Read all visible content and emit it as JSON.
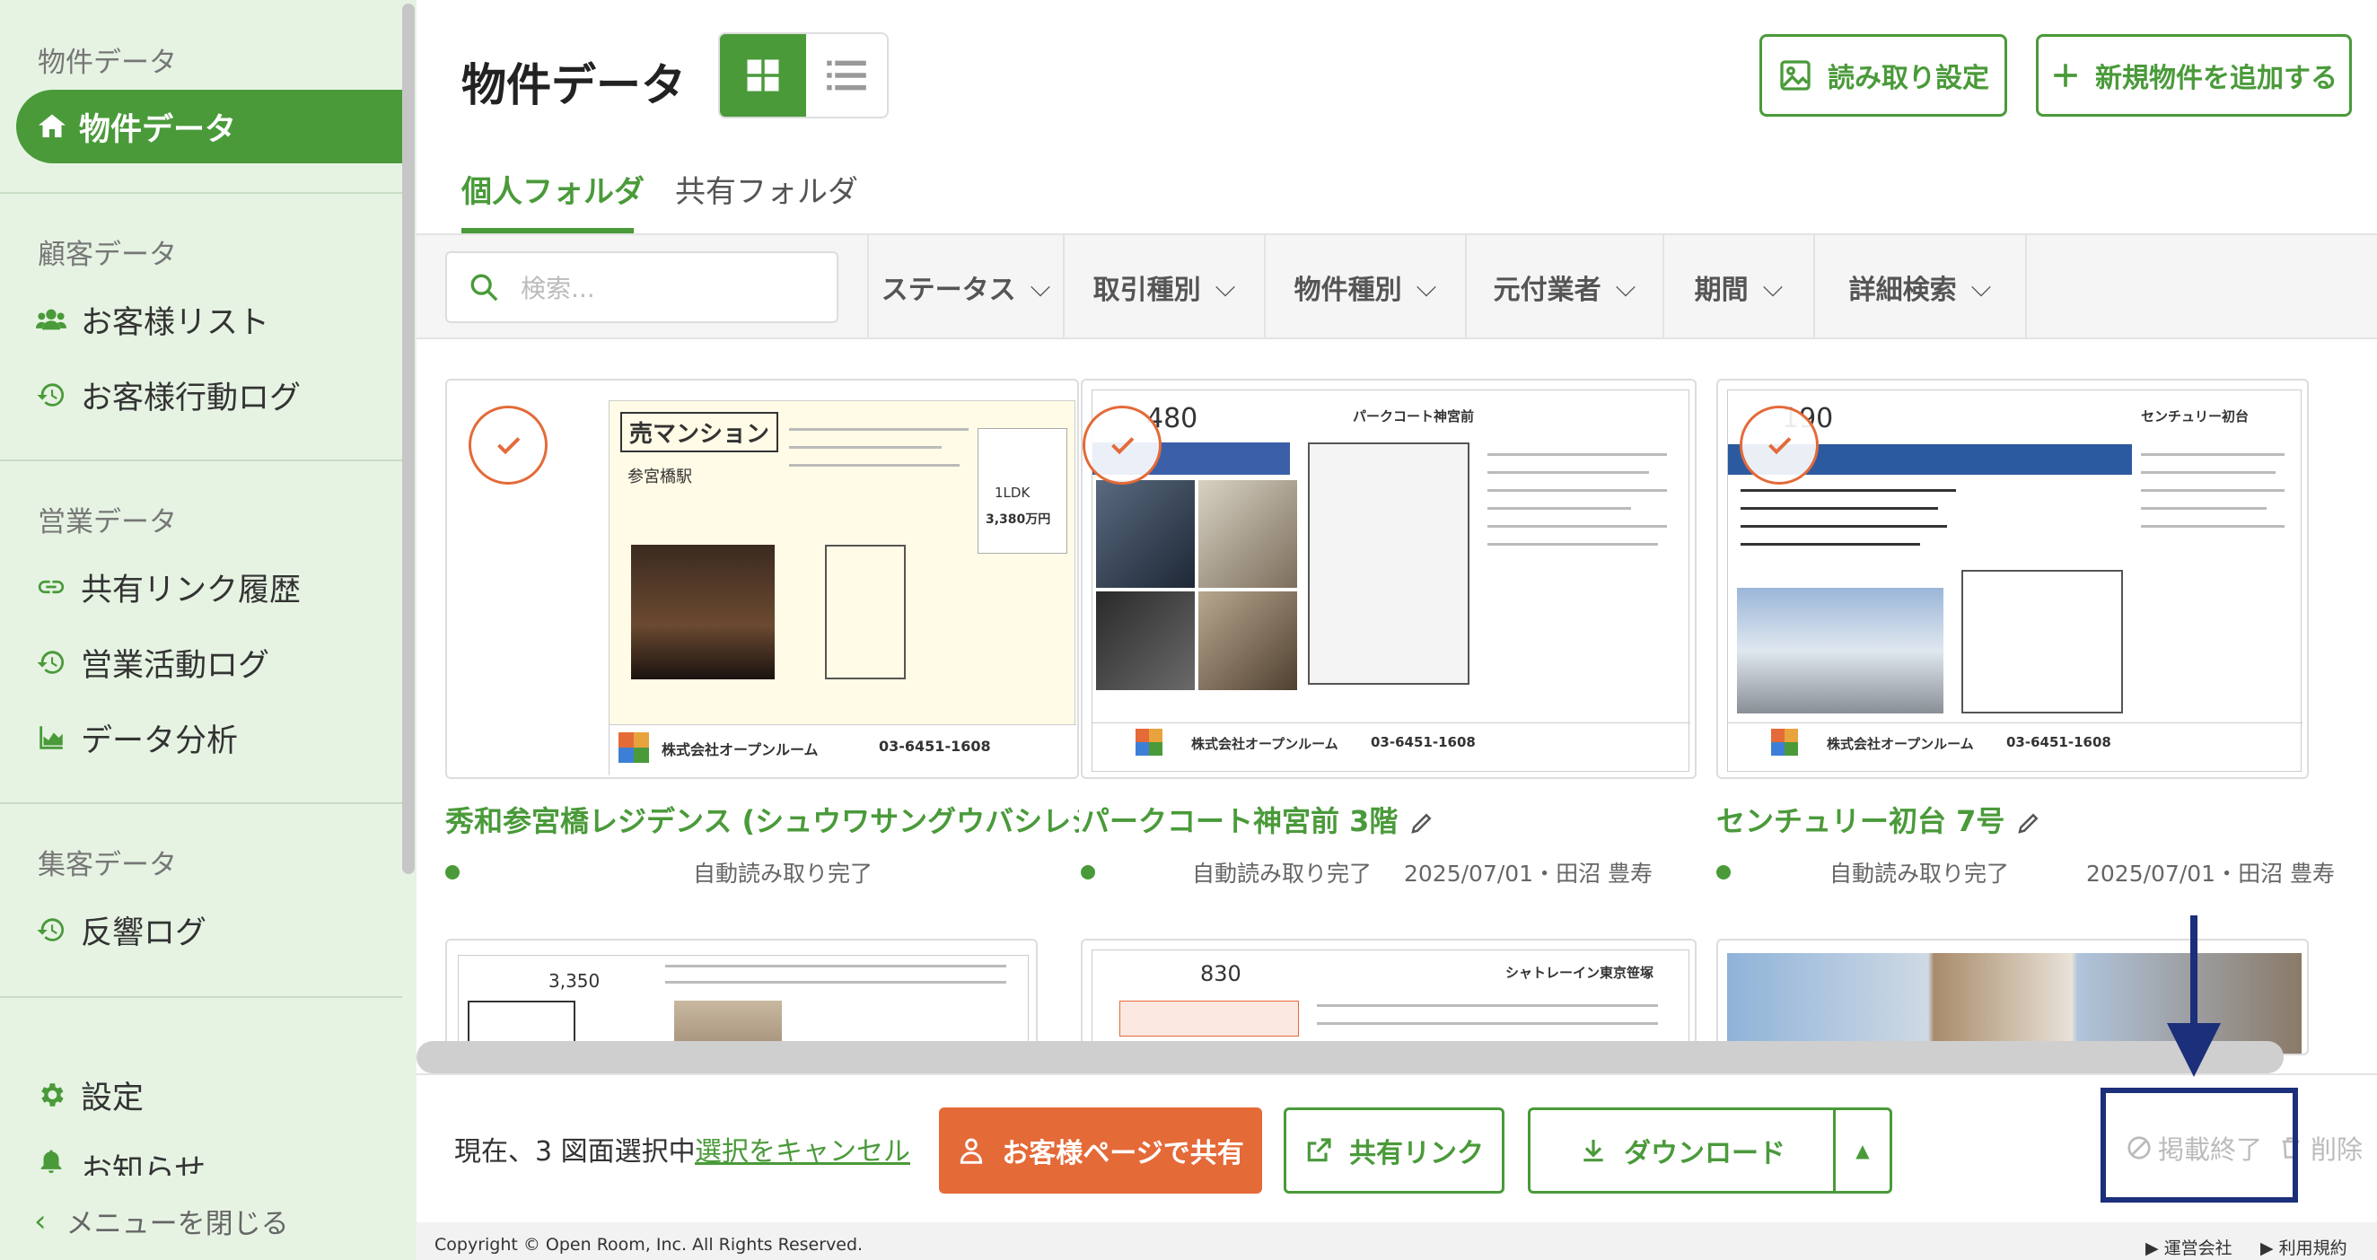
{
  "sidebar": {
    "sections": [
      {
        "heading": "物件データ"
      },
      {
        "heading": "顧客データ"
      },
      {
        "heading": "営業データ"
      },
      {
        "heading": "集客データ"
      }
    ],
    "active_item": "物件データ",
    "items": {
      "customer_list": "お客様リスト",
      "customer_log": "お客様行動ログ",
      "share_history": "共有リンク履歴",
      "sales_log": "営業活動ログ",
      "analytics": "データ分析",
      "response_log": "反響ログ",
      "settings": "設定",
      "notice": "お知らせ"
    },
    "close_menu": "メニューを閉じる"
  },
  "header": {
    "title": "物件データ",
    "scan_settings": "読み取り設定",
    "add_property": "新規物件を追加する"
  },
  "tabs": [
    {
      "label": "個人フォルダ",
      "active": true
    },
    {
      "label": "共有フォルダ",
      "active": false
    }
  ],
  "filters": {
    "search_placeholder": "検索...",
    "items": [
      "ステータス",
      "取引種別",
      "物件種別",
      "元付業者",
      "期間",
      "詳細検索"
    ]
  },
  "cards": [
    {
      "title": "秀和参宮橋レジデンス (シュウワサングウバシレジ",
      "status": "自動読み取り完了",
      "meta": "",
      "selected": true
    },
    {
      "title": "パークコート神宮前 3階",
      "status": "自動読み取り完了",
      "meta": "2025/07/01・田沼 豊寿",
      "selected": true
    },
    {
      "title": "センチュリー初台 7号",
      "status": "自動読み取り完了",
      "meta": "2025/07/01・田沼 豊寿",
      "selected": true
    }
  ],
  "flyer_texts": {
    "mansion_label": "売マンション",
    "station": "参宮橋駅",
    "price_1": "3,380万円",
    "layout_1": "1LDK",
    "company": "株式会社オープンルーム",
    "phone": "03-6451-1608",
    "price_2": "480",
    "building_2": "パークコート神宮前",
    "price_3": "190",
    "building_3": "センチュリー初台",
    "price_4": "3,350",
    "price_5": "830",
    "building_5": "シャトレーイン東京笹塚"
  },
  "action_bar": {
    "selection_text": "現在、3 図面選択中",
    "cancel_selection": "選択をキャンセル",
    "share_customer_page": "お客様ページで共有",
    "share_link": "共有リンク",
    "download": "ダウンロード",
    "end_listing": "掲載終了",
    "delete": "削除"
  },
  "footer": {
    "copyright": "Copyright © Open Room, Inc. All Rights Reserved.",
    "company": "▶ 運営会社",
    "terms": "▶ 利用規約"
  },
  "colors": {
    "brand_green": "#4a9a3a",
    "sidebar_bg": "#e6f3e3",
    "accent_orange": "#e46a38",
    "annotation_navy": "#1c2f7a"
  }
}
